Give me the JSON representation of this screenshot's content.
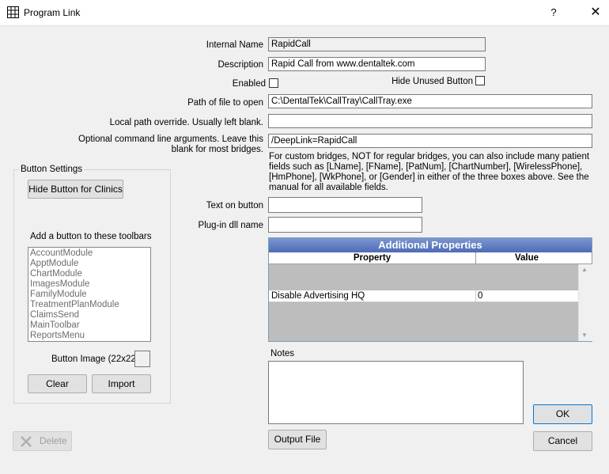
{
  "window": {
    "title": "Program Link",
    "help": "?",
    "close": "✕"
  },
  "form": {
    "internal_name_label": "Internal Name",
    "internal_name_value": "RapidCall",
    "description_label": "Description",
    "description_value": "Rapid Call from www.dentaltek.com",
    "enabled_label": "Enabled",
    "hide_unused_label": "Hide Unused Button",
    "path_label": "Path of file to open",
    "path_value": "C:\\DentalTek\\CallTray\\CallTray.exe",
    "local_override_label": "Local path override.  Usually left blank.",
    "local_override_value": "",
    "cmdline_label_1": "Optional command line arguments.  Leave this",
    "cmdline_label_2": "blank for most bridges.",
    "cmdline_value": "/DeepLink=RapidCall",
    "custom_note": "For custom bridges, NOT for regular bridges, you can also include many patient fields such as [LName], [FName], [PatNum], [ChartNumber], [WirelessPhone], [HmPhone], [WkPhone], or [Gender] in either of the three boxes above. See the manual for all available fields.",
    "text_on_button_label": "Text on button",
    "text_on_button_value": "",
    "plugin_label": "Plug-in dll name",
    "plugin_value": ""
  },
  "button_settings": {
    "group_label": "Button Settings",
    "hide_clinics_label": "Hide Button for Clinics",
    "toolbars_label": "Add a button to these toolbars",
    "toolbars": [
      "AccountModule",
      "ApptModule",
      "ChartModule",
      "ImagesModule",
      "FamilyModule",
      "TreatmentPlanModule",
      "ClaimsSend",
      "MainToolbar",
      "ReportsMenu"
    ],
    "image_label": "Button Image (22x22)",
    "clear_label": "Clear",
    "import_label": "Import"
  },
  "properties": {
    "title": "Additional Properties",
    "col_property": "Property",
    "col_value": "Value",
    "rows": [
      {
        "property": "Disable Advertising HQ",
        "value": "0"
      }
    ]
  },
  "notes": {
    "label": "Notes",
    "value": ""
  },
  "buttons": {
    "delete": "Delete",
    "output_file": "Output File",
    "ok": "OK",
    "cancel": "Cancel"
  },
  "icons": {
    "app": "grid-icon",
    "delete": "x-icon"
  }
}
